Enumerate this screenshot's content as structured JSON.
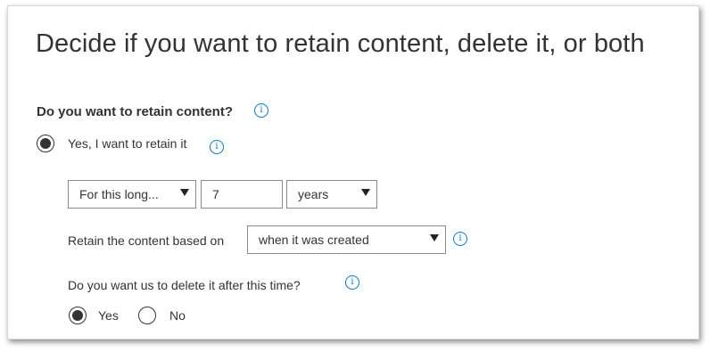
{
  "panel": {
    "title": "Decide if you want to retain content, delete it, or both",
    "retain_question": "Do you want to retain content?",
    "retain_option_label": "Yes, I want to retain it"
  },
  "retention": {
    "duration_mode": "For this long...",
    "duration_value": "7",
    "duration_unit": "years",
    "based_on_label": "Retain the content based on",
    "based_on_value": "when it was created"
  },
  "delete_section": {
    "question": "Do you want us to delete it after this time?",
    "yes_label": "Yes",
    "no_label": "No",
    "selected": "Yes"
  },
  "icons": {
    "info": "info-icon",
    "dropdown": "chevron-down-icon",
    "info_glyph": "i"
  },
  "colors": {
    "accent": "#0078d4",
    "text": "#333333",
    "border": "#8a8a8a"
  }
}
